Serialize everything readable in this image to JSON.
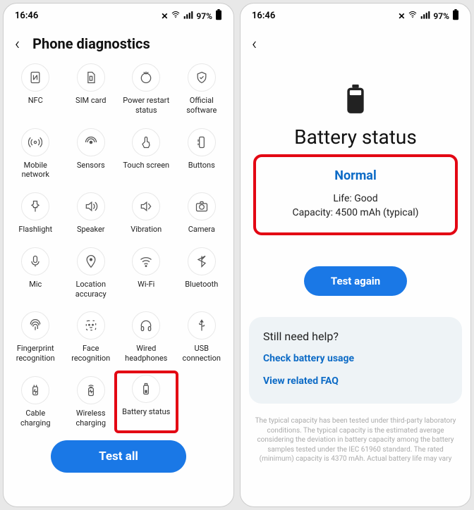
{
  "status": {
    "time": "16:46",
    "battery": "97%"
  },
  "left": {
    "title": "Phone diagnostics",
    "items": [
      {
        "id": "nfc",
        "label": "NFC"
      },
      {
        "id": "sim",
        "label": "SIM card"
      },
      {
        "id": "restart",
        "label": "Power restart status"
      },
      {
        "id": "official",
        "label": "Official software"
      },
      {
        "id": "mobile",
        "label": "Mobile network"
      },
      {
        "id": "sensors",
        "label": "Sensors"
      },
      {
        "id": "touch",
        "label": "Touch screen"
      },
      {
        "id": "buttons",
        "label": "Buttons"
      },
      {
        "id": "flash",
        "label": "Flashlight"
      },
      {
        "id": "speaker",
        "label": "Speaker"
      },
      {
        "id": "vibration",
        "label": "Vibration"
      },
      {
        "id": "camera",
        "label": "Camera"
      },
      {
        "id": "mic",
        "label": "Mic"
      },
      {
        "id": "location",
        "label": "Location accuracy"
      },
      {
        "id": "wifi",
        "label": "Wi-Fi"
      },
      {
        "id": "bt",
        "label": "Bluetooth"
      },
      {
        "id": "fingerprint",
        "label": "Fingerprint recognition"
      },
      {
        "id": "face",
        "label": "Face recognition"
      },
      {
        "id": "headphones",
        "label": "Wired headphones"
      },
      {
        "id": "usb",
        "label": "USB connection"
      },
      {
        "id": "cable",
        "label": "Cable charging"
      },
      {
        "id": "wireless",
        "label": "Wireless charging"
      },
      {
        "id": "battery",
        "label": "Battery status",
        "highlight": true
      }
    ],
    "test_all": "Test all"
  },
  "right": {
    "title": "Battery status",
    "status": "Normal",
    "life": "Life: Good",
    "capacity": "Capacity: 4500 mAh (typical)",
    "test_again": "Test again",
    "help_title": "Still need help?",
    "link1": "Check battery usage",
    "link2": "View related FAQ",
    "disclaimer": "The typical capacity has been tested under third-party laboratory conditions. The typical capacity is the estimated average considering the deviation in battery capacity among the battery samples tested under the IEC 61960 standard. The rated (minimum) capacity is 4370 mAh. Actual battery life may vary"
  }
}
